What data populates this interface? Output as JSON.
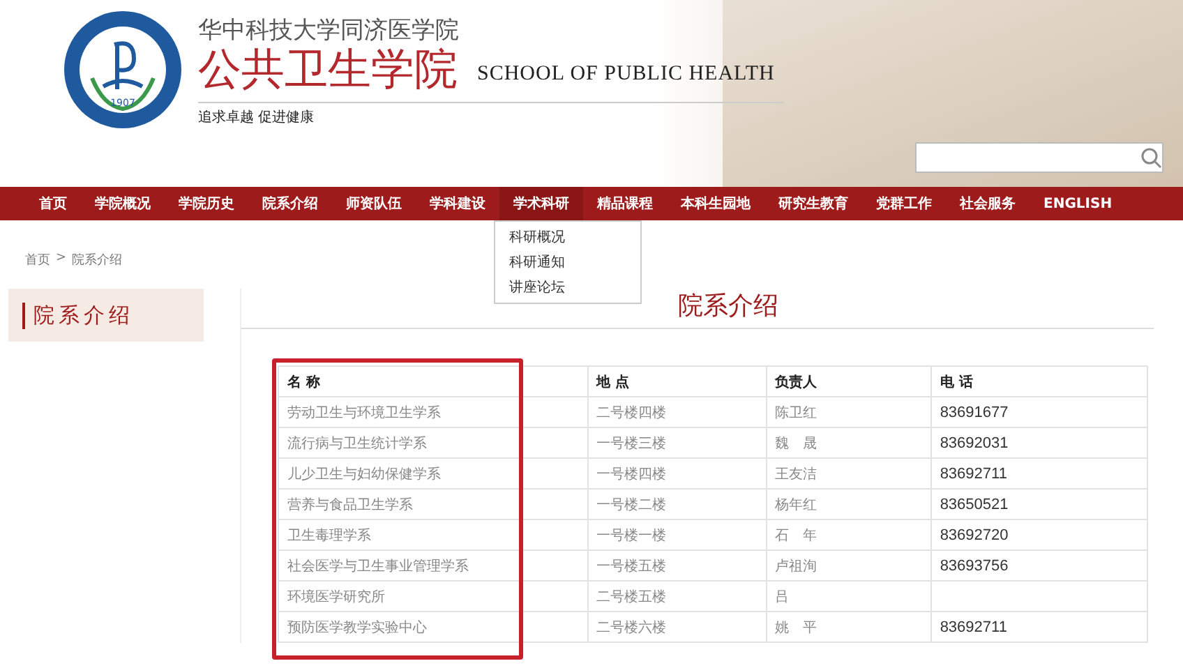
{
  "header": {
    "school": "华中科技大学同济医学院",
    "name": "公共卫生学院",
    "english": "SCHOOL OF PUBLIC HEALTH",
    "motto": "追求卓越 促进健康",
    "logo_year": "1907"
  },
  "nav": [
    {
      "label": "首页",
      "expanded": false
    },
    {
      "label": "学院概况",
      "expanded": false
    },
    {
      "label": "学院历史",
      "expanded": false
    },
    {
      "label": "院系介绍",
      "expanded": false
    },
    {
      "label": "师资队伍",
      "expanded": false
    },
    {
      "label": "学科建设",
      "expanded": false
    },
    {
      "label": "学术科研",
      "expanded": true,
      "submenu": [
        "科研概况",
        "科研通知",
        "讲座论坛"
      ]
    },
    {
      "label": "精品课程",
      "expanded": false
    },
    {
      "label": "本科生园地",
      "expanded": false
    },
    {
      "label": "研究生教育",
      "expanded": false
    },
    {
      "label": "党群工作",
      "expanded": false
    },
    {
      "label": "社会服务",
      "expanded": false
    },
    {
      "label": "ENGLISH",
      "expanded": false
    }
  ],
  "breadcrumb": [
    "首页",
    "院系介绍"
  ],
  "breadcrumb_separator": ">",
  "sidebar": {
    "title": "院系介绍"
  },
  "page_title": "院系介绍",
  "table": {
    "columns": [
      "名 称",
      "地 点",
      "负责人",
      "电 话"
    ],
    "rows": [
      [
        "劳动卫生与环境卫生学系",
        "二号楼四楼",
        "陈卫红",
        "83691677"
      ],
      [
        "流行病与卫生统计学系",
        "一号楼三楼",
        "魏　晟",
        "83692031"
      ],
      [
        "儿少卫生与妇幼保健学系",
        "一号楼四楼",
        "王友洁",
        "83692711"
      ],
      [
        "营养与食品卫生学系",
        "一号楼二楼",
        "杨年红",
        "83650521"
      ],
      [
        "卫生毒理学系",
        "一号楼一楼",
        "石　年",
        "83692720"
      ],
      [
        "社会医学与卫生事业管理学系",
        "一号楼五楼",
        "卢祖洵",
        "83693756"
      ],
      [
        "环境医学研究所",
        "二号楼五楼",
        "吕",
        ""
      ],
      [
        "预防医学教学实验中心",
        "二号楼六楼",
        "姚　平",
        "83692711"
      ]
    ]
  }
}
